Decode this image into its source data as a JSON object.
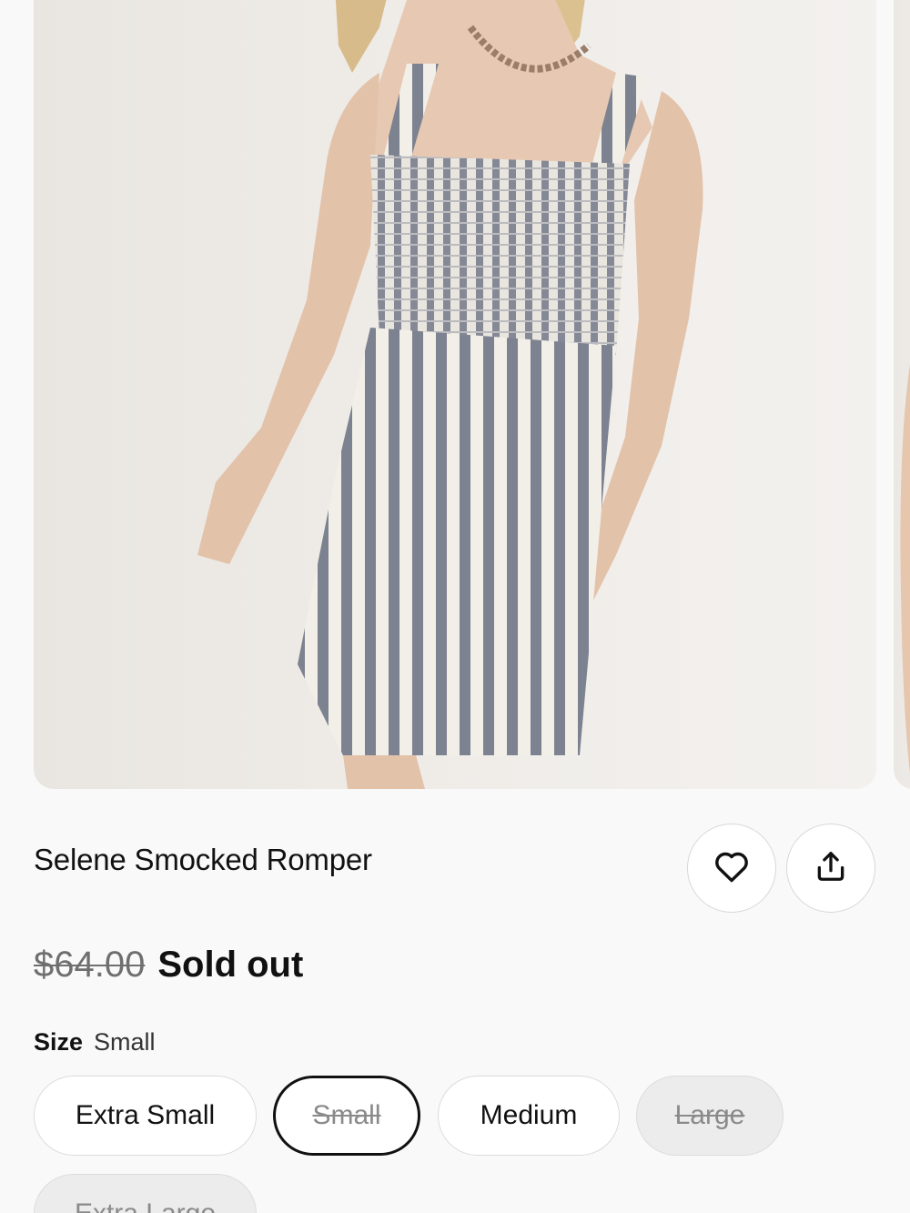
{
  "product": {
    "title": "Selene Smocked Romper",
    "original_price": "$64.00",
    "status": "Sold out"
  },
  "actions": {
    "favorite_icon": "heart-outline-icon",
    "share_icon": "share-upload-icon"
  },
  "size": {
    "label": "Size",
    "selected": "Small",
    "options": [
      {
        "label": "Extra Small",
        "available": true
      },
      {
        "label": "Small",
        "available": false,
        "selected": true
      },
      {
        "label": "Medium",
        "available": true
      },
      {
        "label": "Large",
        "available": false
      },
      {
        "label": "Extra Large",
        "available": false
      }
    ]
  },
  "gallery": {
    "images": [
      "model wearing striped romper",
      "next product image"
    ]
  }
}
